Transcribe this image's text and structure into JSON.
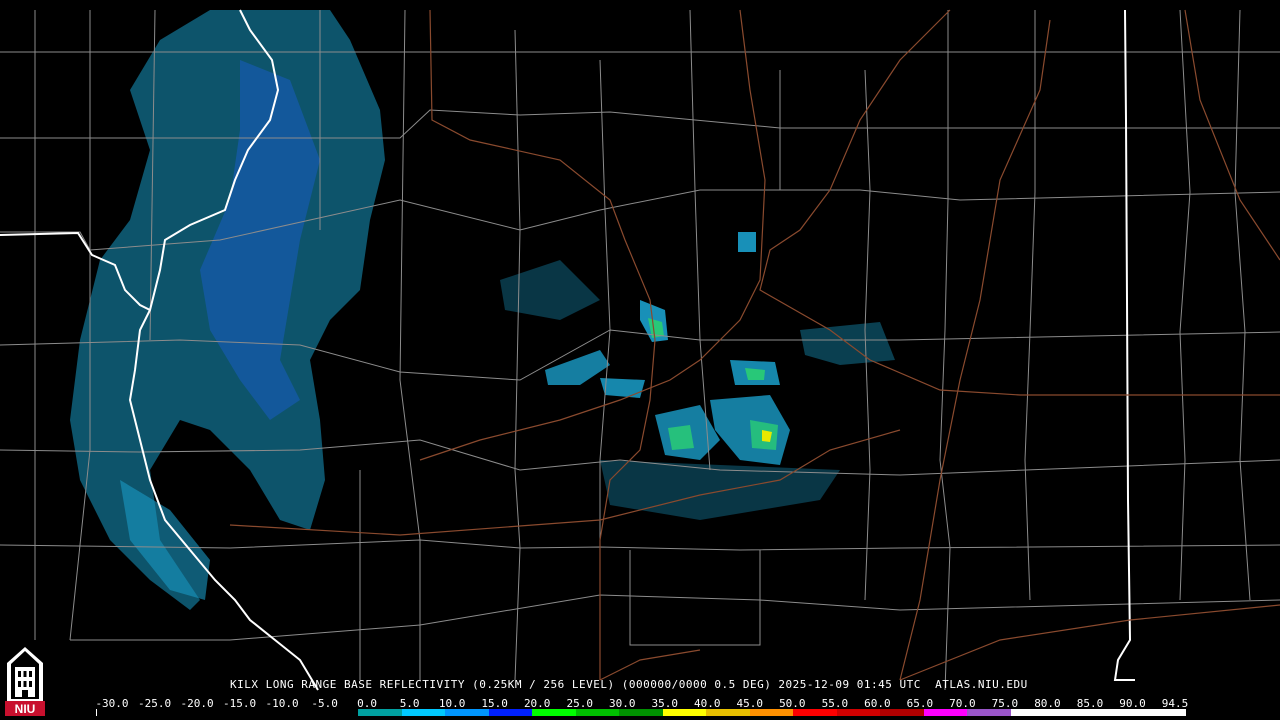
{
  "product": {
    "station": "KILX",
    "caption": "KILX LONG RANGE BASE REFLECTIVITY (0.25KM / 256 LEVEL) (000000/0000 0.5 DEG) 2025-12-09 01:45 UTC  ATLAS.NIU.EDU",
    "product_name": "LONG RANGE BASE REFLECTIVITY",
    "resolution": "0.25KM / 256 LEVEL",
    "elevation": "0.5 DEG",
    "datetime": "2025-12-09 01:45 UTC",
    "site": "ATLAS.NIU.EDU"
  },
  "logo": {
    "text": "NIU",
    "color": "#c8102e",
    "icon": "university-tower-icon"
  },
  "scale": {
    "labels": [
      "-30.0",
      "-25.0",
      "-20.0",
      "-15.0",
      "-10.0",
      "-5.0",
      "0.0",
      "5.0",
      "10.0",
      "15.0",
      "20.0",
      "25.0",
      "30.0",
      "35.0",
      "40.0",
      "45.0",
      "50.0",
      "55.0",
      "60.0",
      "65.0",
      "70.0",
      "75.0",
      "80.0",
      "85.0",
      "90.0",
      "94.5"
    ],
    "colors": [
      "#000000",
      "#000000",
      "#000000",
      "#000000",
      "#000000",
      "#000000",
      "#00a0a0",
      "#00c8ff",
      "#0096ff",
      "#0020ff",
      "#00ff00",
      "#00c000",
      "#009000",
      "#ffff00",
      "#e8c000",
      "#ff9000",
      "#ff0000",
      "#d00000",
      "#b00000",
      "#ff00ff",
      "#9955c8",
      "#ffffff",
      "#ffffff",
      "#ffffff",
      "#ffffff"
    ]
  },
  "map_colors": {
    "county_line": "#8c8c8c",
    "state_line": "#ffffff",
    "highway": "#8a4a2e",
    "echo_light": "#1eb4e6",
    "echo_mid": "#1e6ee6",
    "echo_heavy": "#28c878"
  }
}
